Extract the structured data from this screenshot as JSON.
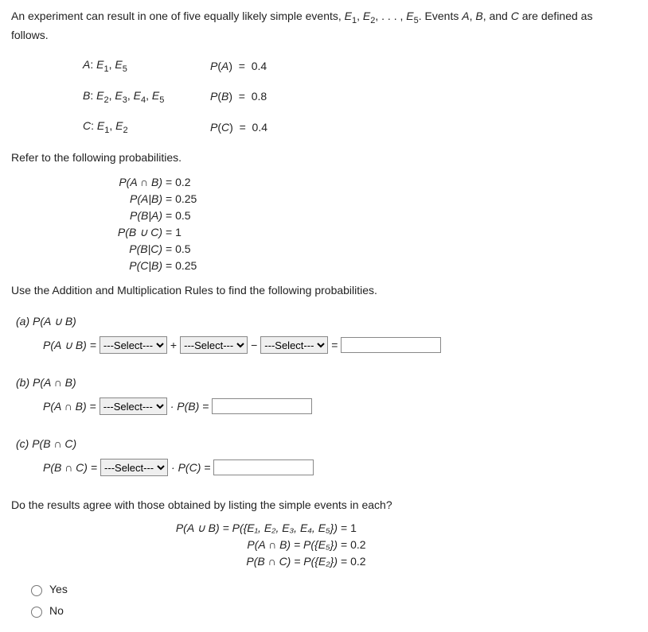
{
  "intro_a": "An experiment can result in one of five equally likely simple events, ",
  "intro_b": ". Events ",
  "intro_c": " are defined as",
  "follows": "follows.",
  "defs": {
    "A_lbl_a": "A: ",
    "A_lbl_b": "E",
    "A_lbl_c": ", E",
    "A_rhs": "P(A)  =  0.4",
    "B_rhs": "P(B)  =  0.8",
    "C_rhs": "P(C)  =  0.4"
  },
  "refer": "Refer to the following probabilities.",
  "ref": {
    "l1a": "P(A ∩ B)",
    "l1b": "=  0.2",
    "l2a": "P(A|B)",
    "l2b": "=  0.25",
    "l3a": "P(B|A)",
    "l3b": "=  0.5",
    "l4a": "P(B ∪ C)",
    "l4b": "=  1",
    "l5a": "P(B|C)",
    "l5b": "=  0.5",
    "l6a": "P(C|B)",
    "l6b": "=  0.25"
  },
  "use": "Use the Addition and Multiplication Rules to find the following probabilities.",
  "a_label": "(a)   P(A ∪ B)",
  "a_eq_lhs": "P(A ∪ B)  = ",
  "plus": " + ",
  "minus": " − ",
  "equals": " = ",
  "b_label": "(b)   P(A ∩ B)",
  "b_eq_lhs": "P(A ∩ B)  = ",
  "dot_pb": " · P(B) = ",
  "c_label": "(c)   P(B ∩ C)",
  "c_eq_lhs": "P(B ∩ C)  = ",
  "dot_pc": " · P(C) = ",
  "agree_q": "Do the results agree with those obtained by listing the simple events in each?",
  "agree": {
    "l1a": "P(A ∪ B)  =  P({E₁, E₂, E₃, E₄, E₅})",
    "l1b": "=  1",
    "l2a": "P(A ∩ B)  =  P({E₅})",
    "l2b": "=  0.2",
    "l3a": "P(B ∩ C)  =  P({E₂})",
    "l3b": "=  0.2"
  },
  "yes": "Yes",
  "no": "No",
  "sel": "---Select---"
}
